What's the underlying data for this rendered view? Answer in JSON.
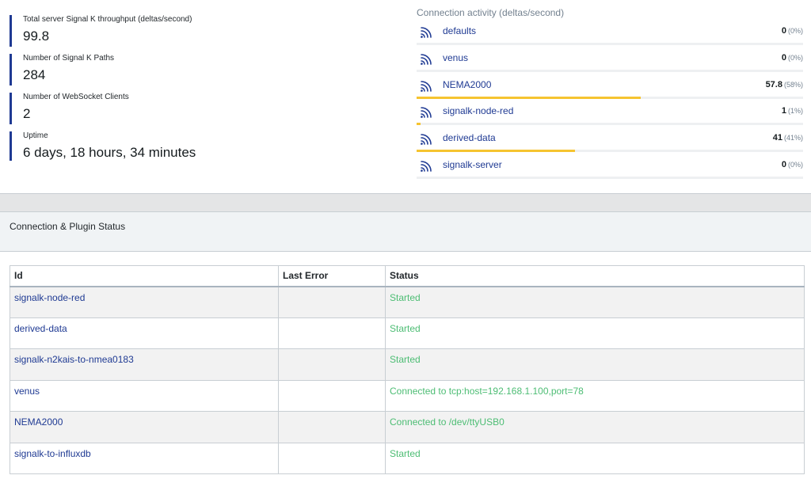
{
  "metrics": [
    {
      "label": "Total server Signal K throughput (deltas/second)",
      "value": "99.8"
    },
    {
      "label": "Number of Signal K Paths",
      "value": "284"
    },
    {
      "label": "Number of WebSocket Clients",
      "value": "2"
    },
    {
      "label": "Uptime",
      "value": "6 days, 18 hours, 34 minutes"
    }
  ],
  "activity": {
    "title": "Connection activity (deltas/second)",
    "connections": [
      {
        "name": "defaults",
        "rate": "0",
        "pct": "(0%)",
        "fraction": 0.0,
        "icon": "wifi-icon"
      },
      {
        "name": "venus",
        "rate": "0",
        "pct": "(0%)",
        "fraction": 0.0,
        "icon": "wifi-icon"
      },
      {
        "name": "NEMA2000",
        "rate": "57.8",
        "pct": "(58%)",
        "fraction": 0.58,
        "icon": "wifi-icon"
      },
      {
        "name": "signalk-node-red",
        "rate": "1",
        "pct": "(1%)",
        "fraction": 0.01,
        "icon": "wifi-icon"
      },
      {
        "name": "derived-data",
        "rate": "41",
        "pct": "(41%)",
        "fraction": 0.41,
        "icon": "wifi-icon"
      },
      {
        "name": "signalk-server",
        "rate": "0",
        "pct": "(0%)",
        "fraction": 0.0,
        "icon": "wifi-icon"
      }
    ],
    "bar_color": "#f6c430"
  },
  "status_card": {
    "title": "Connection & Plugin Status",
    "columns": {
      "id": "Id",
      "error": "Last Error",
      "status": "Status"
    },
    "rows": [
      {
        "id": "signalk-node-red",
        "error": "",
        "status": "Started"
      },
      {
        "id": "derived-data",
        "error": "",
        "status": "Started"
      },
      {
        "id": "signalk-n2kais-to-nmea0183",
        "error": "",
        "status": "Started"
      },
      {
        "id": "venus",
        "error": "",
        "status": "Connected to tcp:host=192.168.1.100,port=78"
      },
      {
        "id": "NEMA2000",
        "error": "",
        "status": "Connected to /dev/ttyUSB0"
      },
      {
        "id": "signalk-to-influxdb",
        "error": "",
        "status": "Started"
      }
    ]
  },
  "colors": {
    "link": "#1f3a93",
    "status_ok": "#4dbd74",
    "accent_border": "#1f3a93"
  }
}
